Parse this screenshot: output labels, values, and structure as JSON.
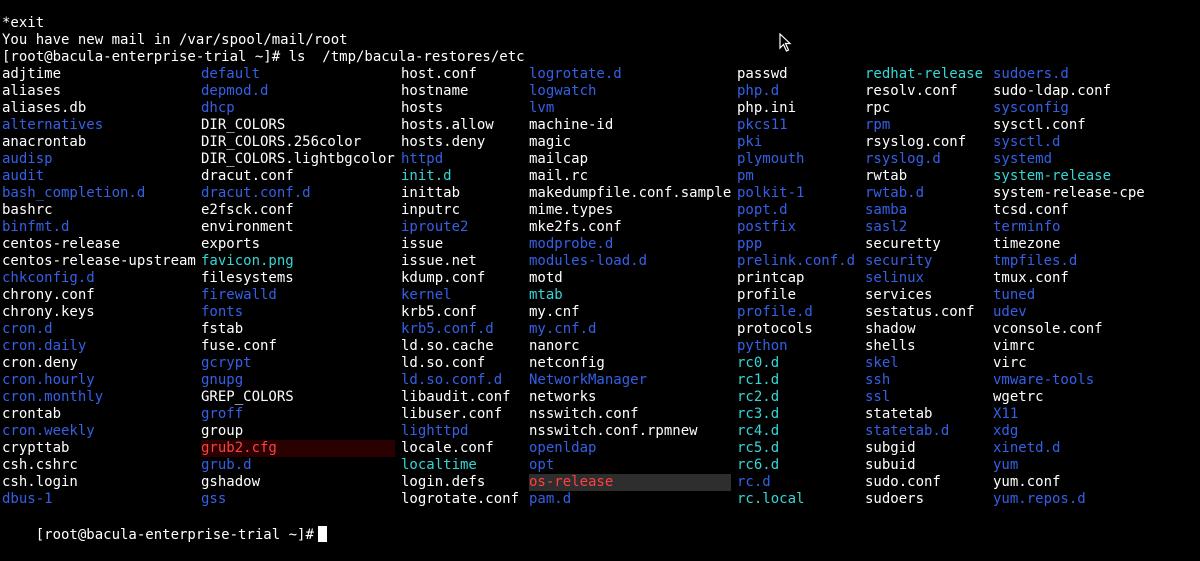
{
  "header_lines": [
    "*exit",
    "You have new mail in /var/spool/mail/root",
    "[root@bacula-enterprise-trial ~]# ls  /tmp/bacula-restores/etc"
  ],
  "final_prompt": "[root@bacula-enterprise-trial ~]#",
  "colors": {
    "background": "#000000",
    "file": "#ffffff",
    "directory": "#3560e6",
    "link": "#36d6d6",
    "executable": "#30d030",
    "highlight": "#ff4040"
  },
  "columns": [
    [
      {
        "n": "adjtime",
        "t": "file"
      },
      {
        "n": "aliases",
        "t": "file"
      },
      {
        "n": "aliases.db",
        "t": "file"
      },
      {
        "n": "alternatives",
        "t": "dir"
      },
      {
        "n": "anacrontab",
        "t": "file"
      },
      {
        "n": "audisp",
        "t": "dir"
      },
      {
        "n": "audit",
        "t": "dir"
      },
      {
        "n": "bash_completion.d",
        "t": "dir"
      },
      {
        "n": "bashrc",
        "t": "file"
      },
      {
        "n": "binfmt.d",
        "t": "dir"
      },
      {
        "n": "centos-release",
        "t": "file"
      },
      {
        "n": "centos-release-upstream",
        "t": "file"
      },
      {
        "n": "chkconfig.d",
        "t": "dir"
      },
      {
        "n": "chrony.conf",
        "t": "file"
      },
      {
        "n": "chrony.keys",
        "t": "file"
      },
      {
        "n": "cron.d",
        "t": "dir"
      },
      {
        "n": "cron.daily",
        "t": "dir"
      },
      {
        "n": "cron.deny",
        "t": "file"
      },
      {
        "n": "cron.hourly",
        "t": "dir"
      },
      {
        "n": "cron.monthly",
        "t": "dir"
      },
      {
        "n": "crontab",
        "t": "file"
      },
      {
        "n": "cron.weekly",
        "t": "dir"
      },
      {
        "n": "crypttab",
        "t": "file"
      },
      {
        "n": "csh.cshrc",
        "t": "file"
      },
      {
        "n": "csh.login",
        "t": "file"
      },
      {
        "n": "dbus-1",
        "t": "dir"
      }
    ],
    [
      {
        "n": "default",
        "t": "dir"
      },
      {
        "n": "depmod.d",
        "t": "dir"
      },
      {
        "n": "dhcp",
        "t": "dir"
      },
      {
        "n": "DIR_COLORS",
        "t": "file"
      },
      {
        "n": "DIR_COLORS.256color",
        "t": "file"
      },
      {
        "n": "DIR_COLORS.lightbgcolor",
        "t": "file"
      },
      {
        "n": "dracut.conf",
        "t": "file"
      },
      {
        "n": "dracut.conf.d",
        "t": "dir"
      },
      {
        "n": "e2fsck.conf",
        "t": "file"
      },
      {
        "n": "environment",
        "t": "file"
      },
      {
        "n": "exports",
        "t": "file"
      },
      {
        "n": "favicon.png",
        "t": "link"
      },
      {
        "n": "filesystems",
        "t": "file"
      },
      {
        "n": "firewalld",
        "t": "dir"
      },
      {
        "n": "fonts",
        "t": "dir"
      },
      {
        "n": "fstab",
        "t": "file"
      },
      {
        "n": "fuse.conf",
        "t": "file"
      },
      {
        "n": "gcrypt",
        "t": "dir"
      },
      {
        "n": "gnupg",
        "t": "dir"
      },
      {
        "n": "GREP_COLORS",
        "t": "file"
      },
      {
        "n": "groff",
        "t": "dir"
      },
      {
        "n": "group",
        "t": "file"
      },
      {
        "n": "grub2.cfg",
        "t": "bad"
      },
      {
        "n": "grub.d",
        "t": "dir"
      },
      {
        "n": "gshadow",
        "t": "file"
      },
      {
        "n": "gss",
        "t": "dir"
      }
    ],
    [
      {
        "n": "host.conf",
        "t": "file"
      },
      {
        "n": "hostname",
        "t": "file"
      },
      {
        "n": "hosts",
        "t": "file"
      },
      {
        "n": "hosts.allow",
        "t": "file"
      },
      {
        "n": "hosts.deny",
        "t": "file"
      },
      {
        "n": "httpd",
        "t": "dir"
      },
      {
        "n": "init.d",
        "t": "link"
      },
      {
        "n": "inittab",
        "t": "file"
      },
      {
        "n": "inputrc",
        "t": "file"
      },
      {
        "n": "iproute2",
        "t": "dir"
      },
      {
        "n": "issue",
        "t": "file"
      },
      {
        "n": "issue.net",
        "t": "file"
      },
      {
        "n": "kdump.conf",
        "t": "file"
      },
      {
        "n": "kernel",
        "t": "dir"
      },
      {
        "n": "krb5.conf",
        "t": "file"
      },
      {
        "n": "krb5.conf.d",
        "t": "dir"
      },
      {
        "n": "ld.so.cache",
        "t": "file"
      },
      {
        "n": "ld.so.conf",
        "t": "file"
      },
      {
        "n": "ld.so.conf.d",
        "t": "dir"
      },
      {
        "n": "libaudit.conf",
        "t": "file"
      },
      {
        "n": "libuser.conf",
        "t": "file"
      },
      {
        "n": "lighttpd",
        "t": "dir"
      },
      {
        "n": "locale.conf",
        "t": "file"
      },
      {
        "n": "localtime",
        "t": "link"
      },
      {
        "n": "login.defs",
        "t": "file"
      },
      {
        "n": "logrotate.conf",
        "t": "file"
      }
    ],
    [
      {
        "n": "logrotate.d",
        "t": "dir"
      },
      {
        "n": "logwatch",
        "t": "dir"
      },
      {
        "n": "lvm",
        "t": "dir"
      },
      {
        "n": "machine-id",
        "t": "file"
      },
      {
        "n": "magic",
        "t": "file"
      },
      {
        "n": "mailcap",
        "t": "file"
      },
      {
        "n": "mail.rc",
        "t": "file"
      },
      {
        "n": "makedumpfile.conf.sample",
        "t": "file"
      },
      {
        "n": "mime.types",
        "t": "file"
      },
      {
        "n": "mke2fs.conf",
        "t": "file"
      },
      {
        "n": "modprobe.d",
        "t": "dir"
      },
      {
        "n": "modules-load.d",
        "t": "dir"
      },
      {
        "n": "motd",
        "t": "file"
      },
      {
        "n": "mtab",
        "t": "link"
      },
      {
        "n": "my.cnf",
        "t": "file"
      },
      {
        "n": "my.cnf.d",
        "t": "dir"
      },
      {
        "n": "nanorc",
        "t": "file"
      },
      {
        "n": "netconfig",
        "t": "file"
      },
      {
        "n": "NetworkManager",
        "t": "dir"
      },
      {
        "n": "networks",
        "t": "file"
      },
      {
        "n": "nsswitch.conf",
        "t": "file"
      },
      {
        "n": "nsswitch.conf.rpmnew",
        "t": "file"
      },
      {
        "n": "openldap",
        "t": "dir"
      },
      {
        "n": "opt",
        "t": "dir"
      },
      {
        "n": "os-release",
        "t": "hl"
      },
      {
        "n": "pam.d",
        "t": "dir"
      }
    ],
    [
      {
        "n": "passwd",
        "t": "file"
      },
      {
        "n": "php.d",
        "t": "dir"
      },
      {
        "n": "php.ini",
        "t": "file"
      },
      {
        "n": "pkcs11",
        "t": "dir"
      },
      {
        "n": "pki",
        "t": "dir"
      },
      {
        "n": "plymouth",
        "t": "dir"
      },
      {
        "n": "pm",
        "t": "dir"
      },
      {
        "n": "polkit-1",
        "t": "dir"
      },
      {
        "n": "popt.d",
        "t": "dir"
      },
      {
        "n": "postfix",
        "t": "dir"
      },
      {
        "n": "ppp",
        "t": "dir"
      },
      {
        "n": "prelink.conf.d",
        "t": "dir"
      },
      {
        "n": "printcap",
        "t": "file"
      },
      {
        "n": "profile",
        "t": "file"
      },
      {
        "n": "profile.d",
        "t": "dir"
      },
      {
        "n": "protocols",
        "t": "file"
      },
      {
        "n": "python",
        "t": "dir"
      },
      {
        "n": "rc0.d",
        "t": "link"
      },
      {
        "n": "rc1.d",
        "t": "link"
      },
      {
        "n": "rc2.d",
        "t": "link"
      },
      {
        "n": "rc3.d",
        "t": "link"
      },
      {
        "n": "rc4.d",
        "t": "link"
      },
      {
        "n": "rc5.d",
        "t": "link"
      },
      {
        "n": "rc6.d",
        "t": "link"
      },
      {
        "n": "rc.d",
        "t": "dir"
      },
      {
        "n": "rc.local",
        "t": "link"
      }
    ],
    [
      {
        "n": "redhat-release",
        "t": "link"
      },
      {
        "n": "resolv.conf",
        "t": "file"
      },
      {
        "n": "rpc",
        "t": "file"
      },
      {
        "n": "rpm",
        "t": "dir"
      },
      {
        "n": "rsyslog.conf",
        "t": "file"
      },
      {
        "n": "rsyslog.d",
        "t": "dir"
      },
      {
        "n": "rwtab",
        "t": "file"
      },
      {
        "n": "rwtab.d",
        "t": "dir"
      },
      {
        "n": "samba",
        "t": "dir"
      },
      {
        "n": "sasl2",
        "t": "dir"
      },
      {
        "n": "securetty",
        "t": "file"
      },
      {
        "n": "security",
        "t": "dir"
      },
      {
        "n": "selinux",
        "t": "dir"
      },
      {
        "n": "services",
        "t": "file"
      },
      {
        "n": "sestatus.conf",
        "t": "file"
      },
      {
        "n": "shadow",
        "t": "file"
      },
      {
        "n": "shells",
        "t": "file"
      },
      {
        "n": "skel",
        "t": "dir"
      },
      {
        "n": "ssh",
        "t": "dir"
      },
      {
        "n": "ssl",
        "t": "dir"
      },
      {
        "n": "statetab",
        "t": "file"
      },
      {
        "n": "statetab.d",
        "t": "dir"
      },
      {
        "n": "subgid",
        "t": "file"
      },
      {
        "n": "subuid",
        "t": "file"
      },
      {
        "n": "sudo.conf",
        "t": "file"
      },
      {
        "n": "sudoers",
        "t": "file"
      }
    ],
    [
      {
        "n": "sudoers.d",
        "t": "dir"
      },
      {
        "n": "sudo-ldap.conf",
        "t": "file"
      },
      {
        "n": "sysconfig",
        "t": "dir"
      },
      {
        "n": "sysctl.conf",
        "t": "file"
      },
      {
        "n": "sysctl.d",
        "t": "dir"
      },
      {
        "n": "systemd",
        "t": "dir"
      },
      {
        "n": "system-release",
        "t": "link"
      },
      {
        "n": "system-release-cpe",
        "t": "file"
      },
      {
        "n": "tcsd.conf",
        "t": "file"
      },
      {
        "n": "terminfo",
        "t": "dir"
      },
      {
        "n": "timezone",
        "t": "file"
      },
      {
        "n": "tmpfiles.d",
        "t": "dir"
      },
      {
        "n": "tmux.conf",
        "t": "file"
      },
      {
        "n": "tuned",
        "t": "dir"
      },
      {
        "n": "udev",
        "t": "dir"
      },
      {
        "n": "vconsole.conf",
        "t": "file"
      },
      {
        "n": "vimrc",
        "t": "file"
      },
      {
        "n": "virc",
        "t": "file"
      },
      {
        "n": "vmware-tools",
        "t": "dir"
      },
      {
        "n": "wgetrc",
        "t": "file"
      },
      {
        "n": "X11",
        "t": "dir"
      },
      {
        "n": "xdg",
        "t": "dir"
      },
      {
        "n": "xinetd.d",
        "t": "dir"
      },
      {
        "n": "yum",
        "t": "dir"
      },
      {
        "n": "yum.conf",
        "t": "file"
      },
      {
        "n": "yum.repos.d",
        "t": "dir"
      }
    ]
  ]
}
